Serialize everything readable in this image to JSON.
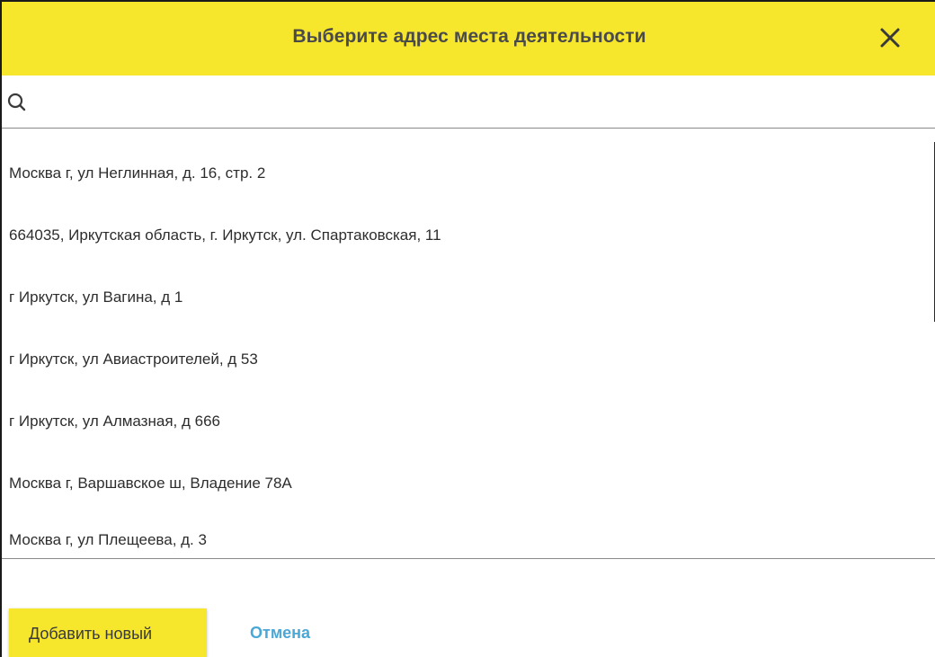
{
  "dialog": {
    "title": "Выберите адрес места деятельности",
    "close_icon": "close-icon"
  },
  "search": {
    "icon": "search-icon",
    "value": "",
    "placeholder": ""
  },
  "addresses": [
    "Москва г, ул Неглинная, д. 16, стр. 2",
    "664035, Иркутская область, г. Иркутск, ул. Спартаковская, 11",
    "г Иркутск, ул Вагина, д 1",
    "г Иркутск, ул Авиастроителей, д 53",
    "г Иркутск, ул Алмазная, д 666",
    "Москва г, Варшавское ш, Владение 78А",
    "Москва г, ул Плещеева, д. 3"
  ],
  "footer": {
    "add_label": "Добавить новый",
    "cancel_label": "Отмена"
  },
  "colors": {
    "accent_yellow": "#f6e62c",
    "link_blue": "#4aa7d6",
    "text_dark": "#2d2d2d"
  }
}
